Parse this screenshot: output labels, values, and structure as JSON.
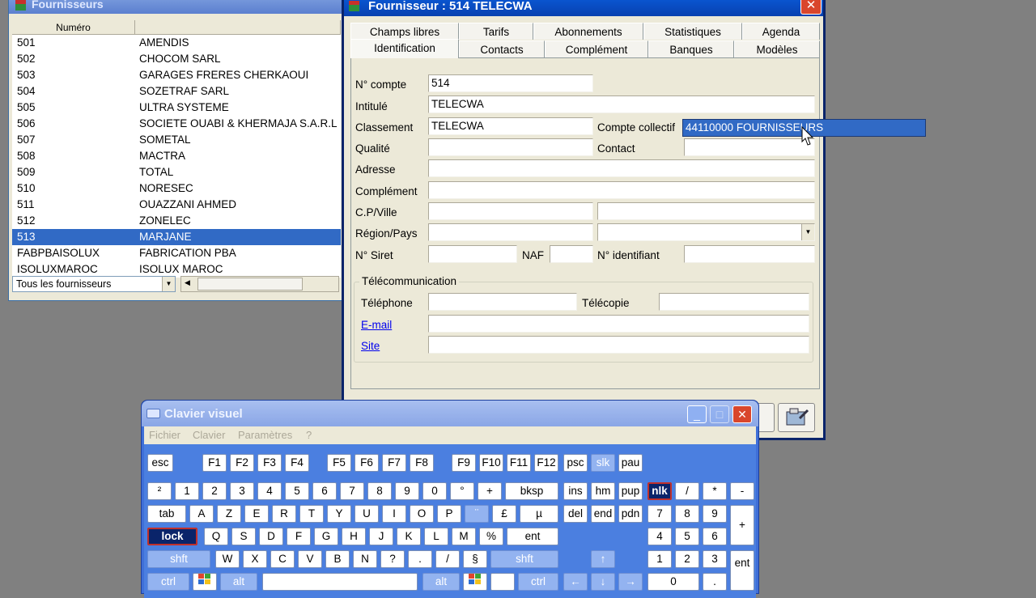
{
  "list_window": {
    "title": "Fournisseurs",
    "columns": [
      "Numéro",
      ""
    ],
    "rows": [
      {
        "num": "501",
        "name": "AMENDIS"
      },
      {
        "num": "502",
        "name": "CHOCOM SARL"
      },
      {
        "num": "503",
        "name": "GARAGES FRERES CHERKAOUI"
      },
      {
        "num": "504",
        "name": "SOZETRAF SARL"
      },
      {
        "num": "505",
        "name": "ULTRA SYSTEME"
      },
      {
        "num": "506",
        "name": "SOCIETE OUABI & KHERMAJA S.A.R.L"
      },
      {
        "num": "507",
        "name": "SOMETAL"
      },
      {
        "num": "508",
        "name": "MACTRA"
      },
      {
        "num": "509",
        "name": "TOTAL"
      },
      {
        "num": "510",
        "name": "NORESEC"
      },
      {
        "num": "511",
        "name": "OUAZZANI AHMED"
      },
      {
        "num": "512",
        "name": "ZONELEC"
      },
      {
        "num": "513",
        "name": "MARJANE"
      },
      {
        "num": "FABPBAISOLUX",
        "name": "FABRICATION PBA"
      },
      {
        "num": "ISOLUXMAROC",
        "name": "ISOLUX MAROC"
      }
    ],
    "selected_num": "513",
    "filter": "Tous les fournisseurs"
  },
  "detail_window": {
    "title": "Fournisseur : 514 TELECWA",
    "close": "✕",
    "tabs_top": [
      "Champs libres",
      "Tarifs",
      "Abonnements",
      "Statistiques",
      "Agenda"
    ],
    "tabs_bottom": [
      "Identification",
      "Contacts",
      "Complément",
      "Banques",
      "Modèles"
    ],
    "active_tab": "Identification",
    "labels": {
      "n_compte": "N° compte",
      "intitule": "Intitulé",
      "classement": "Classement",
      "compte_collectif": "Compte collectif",
      "qualite": "Qualité",
      "contact": "Contact",
      "adresse": "Adresse",
      "complement": "Complément",
      "cp_ville": "C.P/Ville",
      "region_pays": "Région/Pays",
      "n_siret": "N° Siret",
      "naf": "NAF",
      "n_identifiant": "N° identifiant",
      "telecom_group": "Télécommunication",
      "telephone": "Téléphone",
      "telecopie": "Télécopie",
      "email": "E-mail",
      "site": "Site"
    },
    "values": {
      "n_compte": "514",
      "intitule": "TELECWA",
      "classement": "TELECWA",
      "compte_collectif": "44110000 FOURNISSEURS"
    }
  },
  "keyboard_window": {
    "title": "Clavier visuel",
    "menu": [
      "Fichier",
      "Clavier",
      "Paramètres",
      "?"
    ],
    "buttons": {
      "minimize": "_",
      "maximize": "□",
      "close": "✕"
    }
  },
  "keys": {
    "esc": "esc",
    "f1": "F1",
    "f2": "F2",
    "f3": "F3",
    "f4": "F4",
    "f5": "F5",
    "f6": "F6",
    "f7": "F7",
    "f8": "F8",
    "f9": "F9",
    "f10": "F10",
    "f11": "F11",
    "f12": "F12",
    "psc": "psc",
    "slk": "slk",
    "pau": "pau",
    "sup2": "²",
    "d1": "1",
    "d2": "2",
    "d3": "3",
    "d4": "4",
    "d5": "5",
    "d6": "6",
    "d7": "7",
    "d8": "8",
    "d9": "9",
    "d0": "0",
    "deg": "°",
    "plus": "+",
    "bksp": "bksp",
    "ins": "ins",
    "hm": "hm",
    "pup": "pup",
    "nlk": "nlk",
    "slash": "/",
    "star": "*",
    "minus": "-",
    "tab": "tab",
    "a": "A",
    "z": "Z",
    "e": "E",
    "r": "R",
    "t": "T",
    "y": "Y",
    "u": "U",
    "i": "I",
    "o": "O",
    "p": "P",
    "caret": "¨",
    "pound": "£",
    "mu": "µ",
    "del": "del",
    "end": "end",
    "pdn": "pdn",
    "n7": "7",
    "n8": "8",
    "n9": "9",
    "nplus": "+",
    "lock": "lock",
    "q": "Q",
    "s": "S",
    "d": "D",
    "f": "F",
    "g": "G",
    "h": "H",
    "j": "J",
    "k": "K",
    "l": "L",
    "m": "M",
    "pct": "%",
    "ent": "ent",
    "n4": "4",
    "n5": "5",
    "n6": "6",
    "shft": "shft",
    "w": "W",
    "x": "X",
    "c": "C",
    "v": "V",
    "b": "B",
    "n": "N",
    "q2": "?",
    "dot": ".",
    "sl2": "/",
    "sect": "§",
    "shft2": "shft",
    "up": "↑",
    "n1": "1",
    "n2": "2",
    "n3": "3",
    "nent": "ent",
    "ctrl": "ctrl",
    "alt": "alt",
    "altgr": "alt",
    "ctrl2": "ctrl",
    "left": "←",
    "down": "↓",
    "right": "→",
    "n0": "0",
    "ndot": "."
  }
}
